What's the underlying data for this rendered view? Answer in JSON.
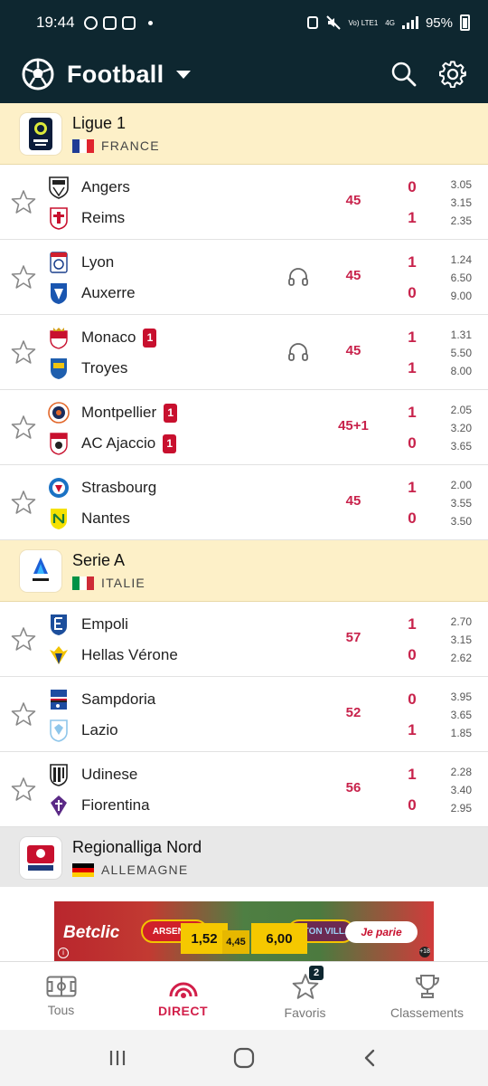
{
  "status": {
    "time": "19:44",
    "network": "Vo) LTE1",
    "net_type": "4G",
    "battery": "95%"
  },
  "appbar": {
    "title": "Football"
  },
  "leagues": [
    {
      "name": "Ligue 1",
      "country": "FRANCE",
      "matches": [
        {
          "home": "Angers",
          "away": "Reims",
          "minute": "45",
          "home_score": "0",
          "away_score": "1",
          "odds": [
            "3.05",
            "3.15",
            "2.35"
          ],
          "home_red": "",
          "away_red": ""
        },
        {
          "home": "Lyon",
          "away": "Auxerre",
          "minute": "45",
          "home_score": "1",
          "away_score": "0",
          "odds": [
            "1.24",
            "6.50",
            "9.00"
          ],
          "home_red": "",
          "away_red": ""
        },
        {
          "home": "Monaco",
          "away": "Troyes",
          "minute": "45",
          "home_score": "1",
          "away_score": "1",
          "odds": [
            "1.31",
            "5.50",
            "8.00"
          ],
          "home_red": "1",
          "away_red": ""
        },
        {
          "home": "Montpellier",
          "away": "AC Ajaccio",
          "minute": "45+1",
          "home_score": "1",
          "away_score": "0",
          "odds": [
            "2.05",
            "3.20",
            "3.65"
          ],
          "home_red": "1",
          "away_red": "1"
        },
        {
          "home": "Strasbourg",
          "away": "Nantes",
          "minute": "45",
          "home_score": "1",
          "away_score": "0",
          "odds": [
            "2.00",
            "3.55",
            "3.50"
          ],
          "home_red": "",
          "away_red": ""
        }
      ]
    },
    {
      "name": "Serie A",
      "country": "ITALIE",
      "matches": [
        {
          "home": "Empoli",
          "away": "Hellas Vérone",
          "minute": "57",
          "home_score": "1",
          "away_score": "0",
          "odds": [
            "2.70",
            "3.15",
            "2.62"
          ],
          "home_red": "",
          "away_red": ""
        },
        {
          "home": "Sampdoria",
          "away": "Lazio",
          "minute": "52",
          "home_score": "0",
          "away_score": "1",
          "odds": [
            "3.95",
            "3.65",
            "1.85"
          ],
          "home_red": "",
          "away_red": ""
        },
        {
          "home": "Udinese",
          "away": "Fiorentina",
          "minute": "56",
          "home_score": "1",
          "away_score": "0",
          "odds": [
            "2.28",
            "3.40",
            "2.95"
          ],
          "home_red": "",
          "away_red": ""
        }
      ]
    },
    {
      "name": "Regionalliga Nord",
      "country": "ALLEMAGNE"
    }
  ],
  "ad": {
    "brand": "Betclic",
    "team1": "ARSENAL",
    "team2": "ASTON VILLA",
    "odd1": "1,52",
    "oddx": "4,45",
    "odd2": "6,00",
    "cta": "Je parie",
    "age": "+18"
  },
  "bottom_nav": {
    "items": [
      {
        "label": "Tous",
        "icon": "pitch-icon"
      },
      {
        "label": "DIRECT",
        "icon": "live-icon"
      },
      {
        "label": "Favoris",
        "icon": "star-icon",
        "badge": "2"
      },
      {
        "label": "Classements",
        "icon": "trophy-icon"
      }
    ]
  },
  "colors": {
    "header": "#0e2730",
    "accent": "#c8224b",
    "league_bg": "#fdf0c8",
    "red_card": "#c8102e"
  }
}
